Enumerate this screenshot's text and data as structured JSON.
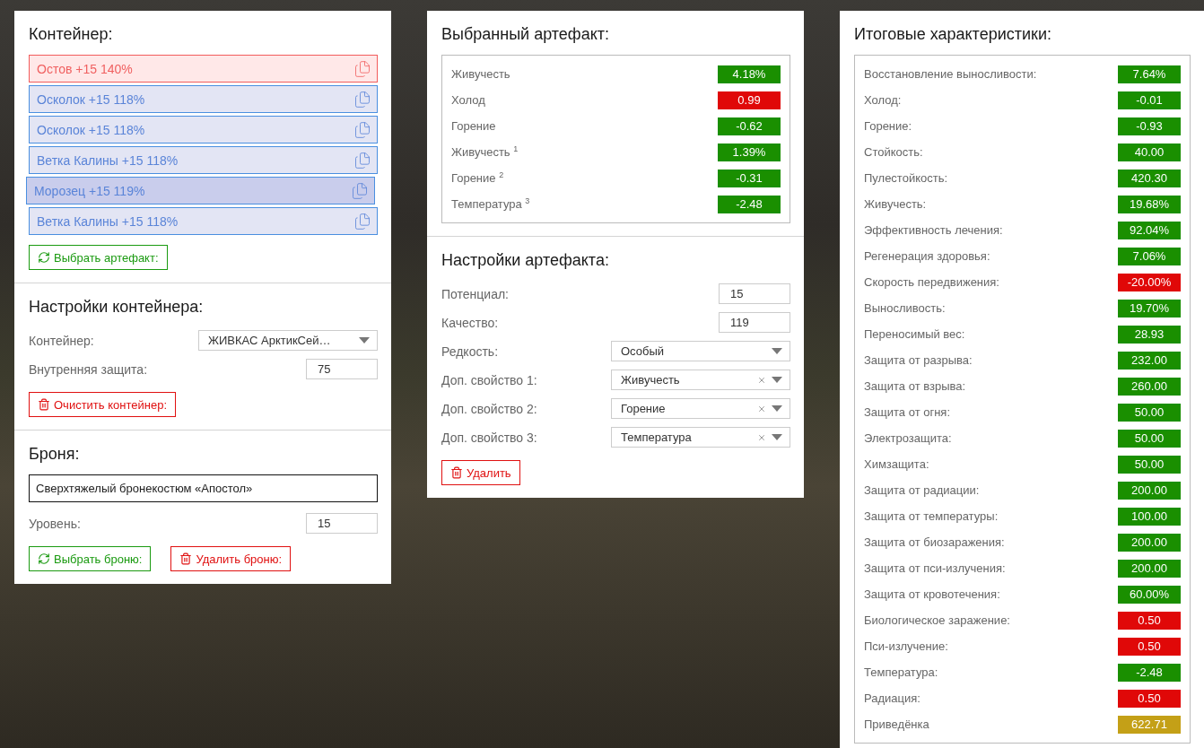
{
  "container": {
    "title": "Контейнер:",
    "artifacts": [
      {
        "label": "Остов +15 140%",
        "kind": "base",
        "selected": false
      },
      {
        "label": "Осколок +15 118%",
        "kind": "artifact",
        "selected": false
      },
      {
        "label": "Осколок +15 118%",
        "kind": "artifact",
        "selected": false
      },
      {
        "label": "Ветка Калины +15 118%",
        "kind": "artifact",
        "selected": false
      },
      {
        "label": "Морозец +15 119%",
        "kind": "artifact",
        "selected": true
      },
      {
        "label": "Ветка Калины +15 118%",
        "kind": "artifact",
        "selected": false
      }
    ],
    "select_button": "Выбрать артефакт:"
  },
  "container_settings": {
    "title": "Настройки контейнера:",
    "fields": [
      {
        "label": "Контейнер:",
        "kind": "select",
        "value": "ЖИВКАС АрктикСей…"
      },
      {
        "label": "Внутренняя защита:",
        "kind": "number",
        "value": "75"
      }
    ],
    "clear_button": "Очистить контейнер:"
  },
  "armor": {
    "title": "Броня:",
    "name": "Сверхтяжелый бронекостюм «Апостол»",
    "fields": [
      {
        "label": "Уровень:",
        "kind": "number",
        "value": "15"
      }
    ],
    "select_button": "Выбрать броню:",
    "remove_button": "Удалить броню:"
  },
  "selected_artifact": {
    "title": "Выбранный артефакт:",
    "stats": [
      {
        "label": "Живучесть",
        "value": "4.18%",
        "color": "#1a8f00"
      },
      {
        "label": "Холод",
        "value": "0.99",
        "color": "#e00808"
      },
      {
        "label": "Горение",
        "value": "-0.62",
        "color": "#1a8f00"
      },
      {
        "label": "Живучесть $^{1}$",
        "value": "1.39%",
        "color": "#1a8f00"
      },
      {
        "label": "Горение $^{2}$",
        "value": "-0.31",
        "color": "#1a8f00"
      },
      {
        "label": "Температура $^{3}$",
        "value": "-2.48",
        "color": "#1a8f00"
      }
    ]
  },
  "artifact_settings": {
    "title": "Настройки артефакта:",
    "fields": [
      {
        "label": "Потенциал:",
        "kind": "number",
        "value": "15"
      },
      {
        "label": "Качество:",
        "kind": "number",
        "value": "119"
      },
      {
        "label": "Редкость:",
        "kind": "select",
        "value": "Особый"
      },
      {
        "label": "Доп. свойство 1:",
        "kind": "clearable",
        "value": "Живучесть"
      },
      {
        "label": "Доп. свойство 2:",
        "kind": "clearable",
        "value": "Горение"
      },
      {
        "label": "Доп. свойство 3:",
        "kind": "clearable",
        "value": "Температура"
      }
    ],
    "delete_button": "Удалить"
  },
  "totals": {
    "title": "Итоговые характеристики:",
    "stats": [
      {
        "label": "Восстановление выносливости:",
        "value": "7.64%",
        "color": "#1a8f00"
      },
      {
        "label": "Холод:",
        "value": "-0.01",
        "color": "#1a8f00"
      },
      {
        "label": "Горение:",
        "value": "-0.93",
        "color": "#1a8f00"
      },
      {
        "label": "Стойкость:",
        "value": "40.00",
        "color": "#1a8f00"
      },
      {
        "label": "Пулестойкость:",
        "value": "420.30",
        "color": "#1a8f00"
      },
      {
        "label": "Живучесть:",
        "value": "19.68%",
        "color": "#1a8f00"
      },
      {
        "label": "Эффективность лечения:",
        "value": "92.04%",
        "color": "#1a8f00"
      },
      {
        "label": "Регенерация здоровья:",
        "value": "7.06%",
        "color": "#1a8f00"
      },
      {
        "label": "Скорость передвижения:",
        "value": "-20.00%",
        "color": "#e00808"
      },
      {
        "label": "Выносливость:",
        "value": "19.70%",
        "color": "#1a8f00"
      },
      {
        "label": "Переносимый вес:",
        "value": "28.93",
        "color": "#1a8f00"
      },
      {
        "label": "Защита от разрыва:",
        "value": "232.00",
        "color": "#1a8f00"
      },
      {
        "label": "Защита от взрыва:",
        "value": "260.00",
        "color": "#1a8f00"
      },
      {
        "label": "Защита от огня:",
        "value": "50.00",
        "color": "#1a8f00"
      },
      {
        "label": "Электрозащита:",
        "value": "50.00",
        "color": "#1a8f00"
      },
      {
        "label": "Химзащита:",
        "value": "50.00",
        "color": "#1a8f00"
      },
      {
        "label": "Защита от радиации:",
        "value": "200.00",
        "color": "#1a8f00"
      },
      {
        "label": "Защита от температуры:",
        "value": "100.00",
        "color": "#1a8f00"
      },
      {
        "label": "Защита от биозаражения:",
        "value": "200.00",
        "color": "#1a8f00"
      },
      {
        "label": "Защита от пси-излучения:",
        "value": "200.00",
        "color": "#1a8f00"
      },
      {
        "label": "Защита от кровотечения:",
        "value": "60.00%",
        "color": "#1a8f00"
      },
      {
        "label": "Биологическое заражение:",
        "value": "0.50",
        "color": "#e00808"
      },
      {
        "label": "Пси-излучение:",
        "value": "0.50",
        "color": "#e00808"
      },
      {
        "label": "Температура:",
        "value": "-2.48",
        "color": "#1a8f00"
      },
      {
        "label": "Радиация:",
        "value": "0.50",
        "color": "#e00808"
      },
      {
        "label": "Приведёнка",
        "value": "622.71",
        "color": "#c4a017"
      }
    ]
  }
}
